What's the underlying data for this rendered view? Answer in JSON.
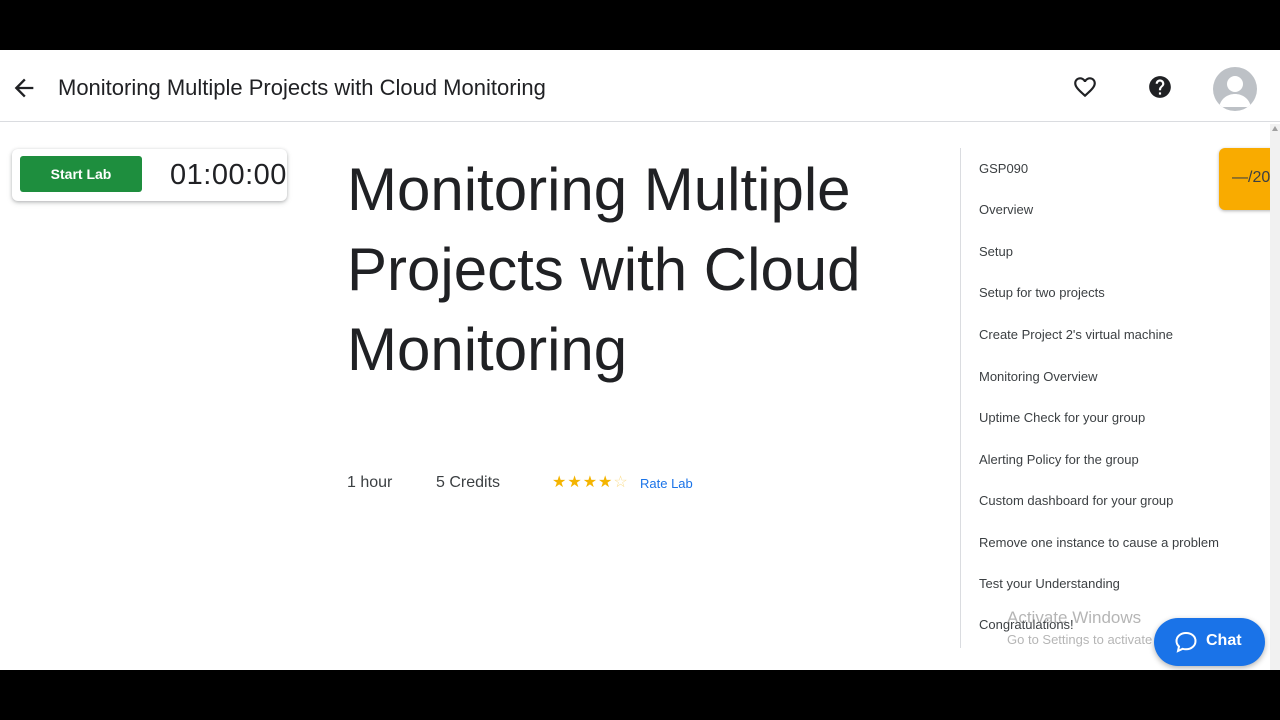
{
  "header": {
    "title": "Monitoring Multiple Projects with Cloud Monitoring",
    "icons": [
      "back-arrow-icon",
      "heart-icon",
      "help-icon",
      "avatar-icon"
    ]
  },
  "lab_card": {
    "start_label": "Start Lab",
    "timer": "01:00:00",
    "start_color": "#1e8e3e"
  },
  "main": {
    "title": "Monitoring Multiple Projects with Cloud Monitoring",
    "duration": "1 hour",
    "credits": "5 Credits",
    "rating": {
      "value": 4,
      "max": 5
    },
    "rate_label": "Rate Lab"
  },
  "toc": {
    "items": [
      "GSP090",
      "Overview",
      "Setup",
      "Setup for two projects",
      "Create Project 2's virtual machine",
      "Monitoring Overview",
      "Uptime Check for your group",
      "Alerting Policy for the group",
      "Custom dashboard for your group",
      "Remove one instance to cause a problem",
      "Test your Understanding",
      "Congratulations!"
    ]
  },
  "score": {
    "text": "—/20",
    "color": "#f9ab00"
  },
  "watermark": {
    "line1": "Activate Windows",
    "line2": "Go to Settings to activate Windows."
  },
  "chat": {
    "label": "Chat",
    "color": "#1a73e8"
  }
}
